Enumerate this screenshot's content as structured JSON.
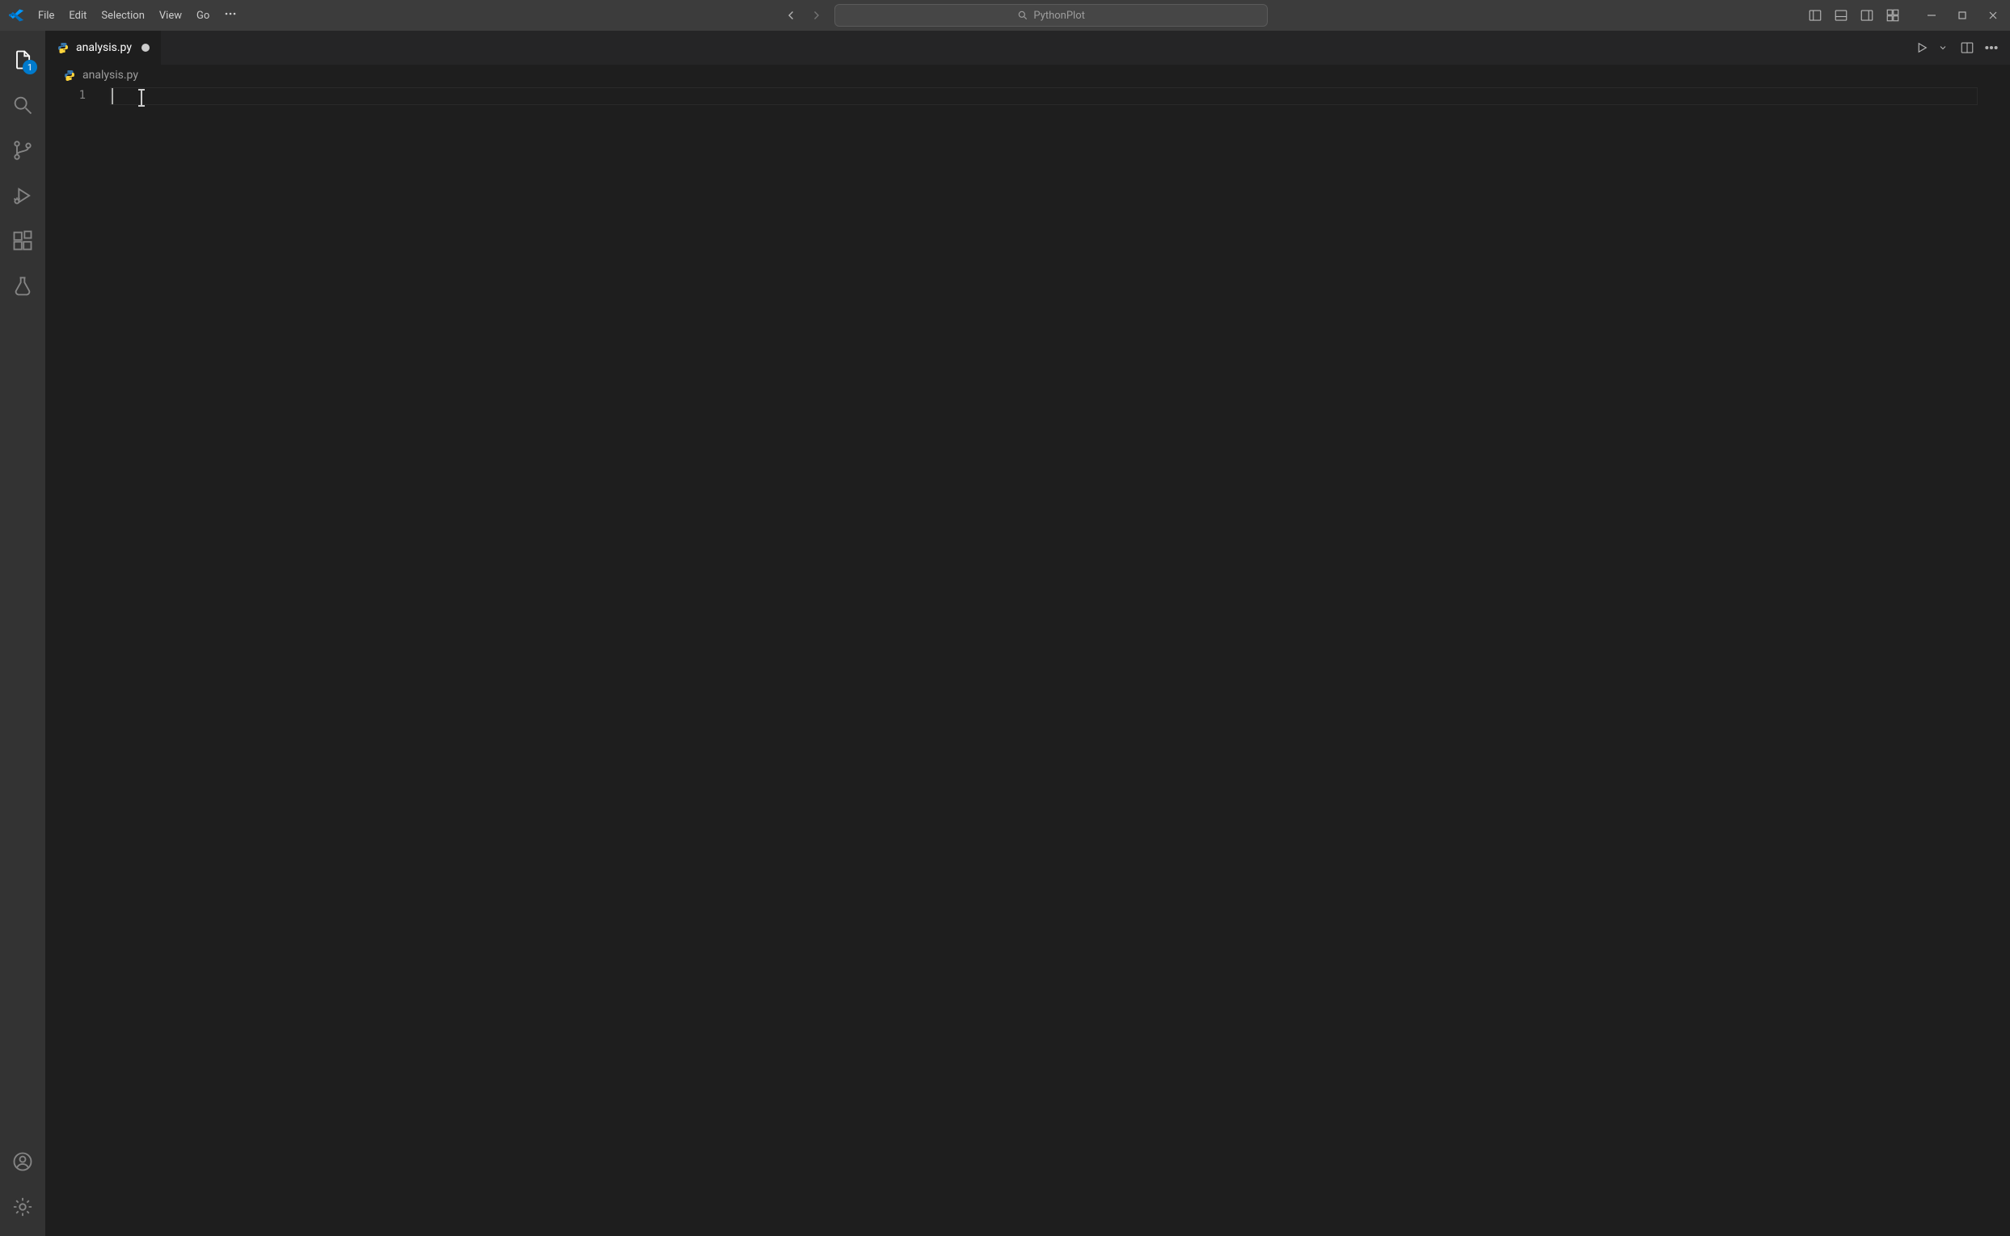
{
  "menubar": {
    "items": [
      "File",
      "Edit",
      "Selection",
      "View",
      "Go"
    ],
    "overflow": "…"
  },
  "commandCenter": {
    "text": "PythonPlot"
  },
  "activitybar": {
    "explorer_badge": "1"
  },
  "tabs": {
    "active": {
      "label": "analysis.py",
      "dirty": true
    }
  },
  "breadcrumb": {
    "file": "analysis.py"
  },
  "editor": {
    "line_numbers": [
      "1"
    ],
    "content": ""
  }
}
